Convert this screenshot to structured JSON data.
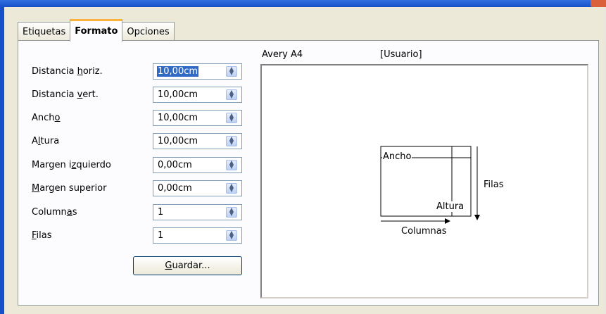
{
  "tabs": [
    {
      "label": "Etiquetas",
      "active": false
    },
    {
      "label": "Formato",
      "active": true
    },
    {
      "label": "Opciones",
      "active": false
    }
  ],
  "fields": [
    {
      "label_pre": "Distancia ",
      "label_key": "h",
      "label_post": "oriz.",
      "value": "10,00cm"
    },
    {
      "label_pre": "Distancia ",
      "label_key": "v",
      "label_post": "ert.",
      "value": "10,00cm"
    },
    {
      "label_pre": "Anch",
      "label_key": "o",
      "label_post": "",
      "value": "10,00cm"
    },
    {
      "label_pre": "A",
      "label_key": "l",
      "label_post": "tura",
      "value": "10,00cm"
    },
    {
      "label_pre": "Margen i",
      "label_key": "z",
      "label_post": "quierdo",
      "value": "0,00cm"
    },
    {
      "label_pre": "",
      "label_key": "M",
      "label_post": "argen superior",
      "value": "0,00cm"
    },
    {
      "label_pre": "Column",
      "label_key": "a",
      "label_post": "s",
      "value": "1"
    },
    {
      "label_pre": "",
      "label_key": "F",
      "label_post": "ilas",
      "value": "1"
    }
  ],
  "save_button": {
    "key": "G",
    "rest": "uardar..."
  },
  "preview": {
    "brand": "Avery A4",
    "type": "[Usuario]",
    "labels": {
      "ancho": "Ancho",
      "altura": "Altura",
      "filas": "Filas",
      "columnas": "Columnas"
    }
  },
  "colors": {
    "selection": "#316ac5",
    "tab_highlight": "#f9b33c",
    "title_bar": "#1650c8"
  }
}
